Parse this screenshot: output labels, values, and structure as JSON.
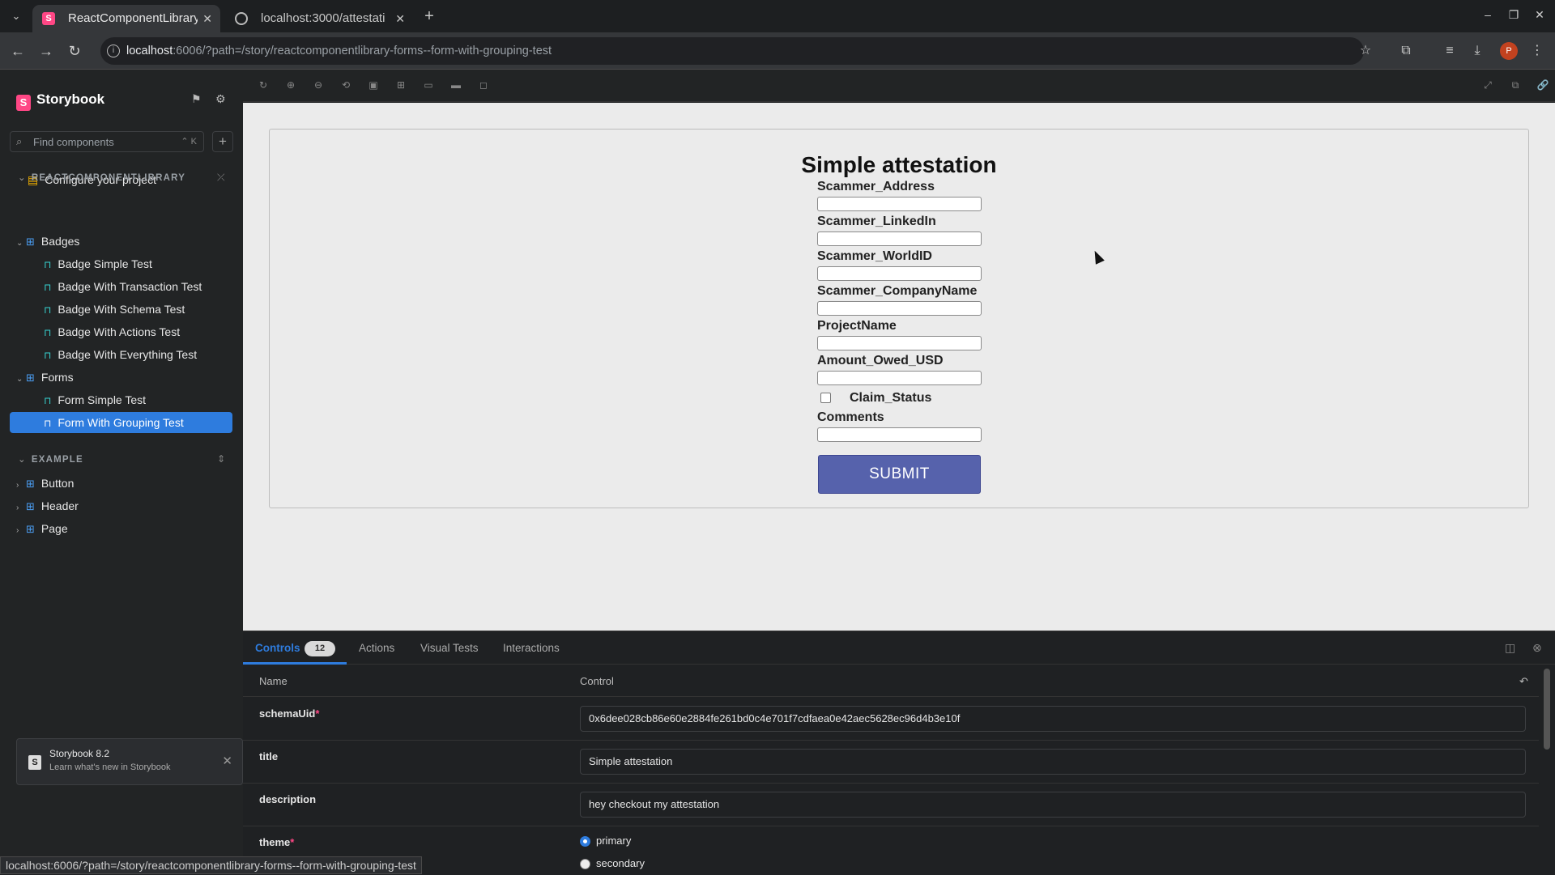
{
  "browser": {
    "tabs": [
      {
        "title": "ReactComponentLibrary",
        "active": true
      },
      {
        "title": "localhost:3000/attestati",
        "active": false
      }
    ],
    "url_host": "localhost",
    "url_rest": ":6006/?path=/story/reactcomponentlibrary-forms--form-with-grouping-test",
    "profile_initial": "P"
  },
  "sidebar": {
    "brand": "Storybook",
    "search_placeholder": "Find components",
    "search_shortcut": "⌃ K",
    "configure_label": "Configure your project",
    "group1_label": "REACTCOMPONENTLIBRARY",
    "group2_label": "EXAMPLE",
    "items": [
      {
        "label": "Badges",
        "kind": "component"
      },
      {
        "label": "Badge Simple Test",
        "kind": "story"
      },
      {
        "label": "Badge With Transaction Test",
        "kind": "story"
      },
      {
        "label": "Badge With Schema Test",
        "kind": "story"
      },
      {
        "label": "Badge With Actions Test",
        "kind": "story"
      },
      {
        "label": "Badge With Everything Test",
        "kind": "story"
      },
      {
        "label": "Forms",
        "kind": "component"
      },
      {
        "label": "Form Simple Test",
        "kind": "story"
      },
      {
        "label": "Form With Grouping Test",
        "kind": "story",
        "selected": true
      }
    ],
    "example_items": [
      {
        "label": "Button"
      },
      {
        "label": "Header"
      },
      {
        "label": "Page"
      }
    ],
    "toast_title": "Storybook 8.2",
    "toast_subtitle": "Learn what's new in Storybook",
    "status_url": "localhost:6006/?path=/story/reactcomponentlibrary-forms--form-with-grouping-test"
  },
  "form": {
    "title": "Simple attestation",
    "fields": [
      {
        "label": "Scammer_Address"
      },
      {
        "label": "Scammer_LinkedIn"
      },
      {
        "label": "Scammer_WorldID"
      },
      {
        "label": "Scammer_CompanyName"
      },
      {
        "label": "ProjectName"
      },
      {
        "label": "Amount_Owed_USD"
      }
    ],
    "checkbox_label": "Claim_Status",
    "comments_label": "Comments",
    "submit_label": "SUBMIT"
  },
  "panel": {
    "tabs": [
      {
        "label": "Controls"
      },
      {
        "label": "Actions"
      },
      {
        "label": "Visual Tests"
      },
      {
        "label": "Interactions"
      }
    ],
    "controls_count": "12",
    "col_name": "Name",
    "col_control": "Control",
    "rows": [
      {
        "name": "schemaUid",
        "required": "*",
        "value": "0x6dee028cb86e60e2884fe261bd0c4e701f7cdfaea0e42aec5628ec96d4b3e10f"
      },
      {
        "name": "title",
        "required": "",
        "value": "Simple attestation"
      },
      {
        "name": "description",
        "required": "",
        "value": "hey checkout my attestation"
      }
    ],
    "theme_name": "theme",
    "theme_required": "*",
    "theme_options": [
      "primary",
      "secondary"
    ],
    "theme_selected": "primary"
  }
}
